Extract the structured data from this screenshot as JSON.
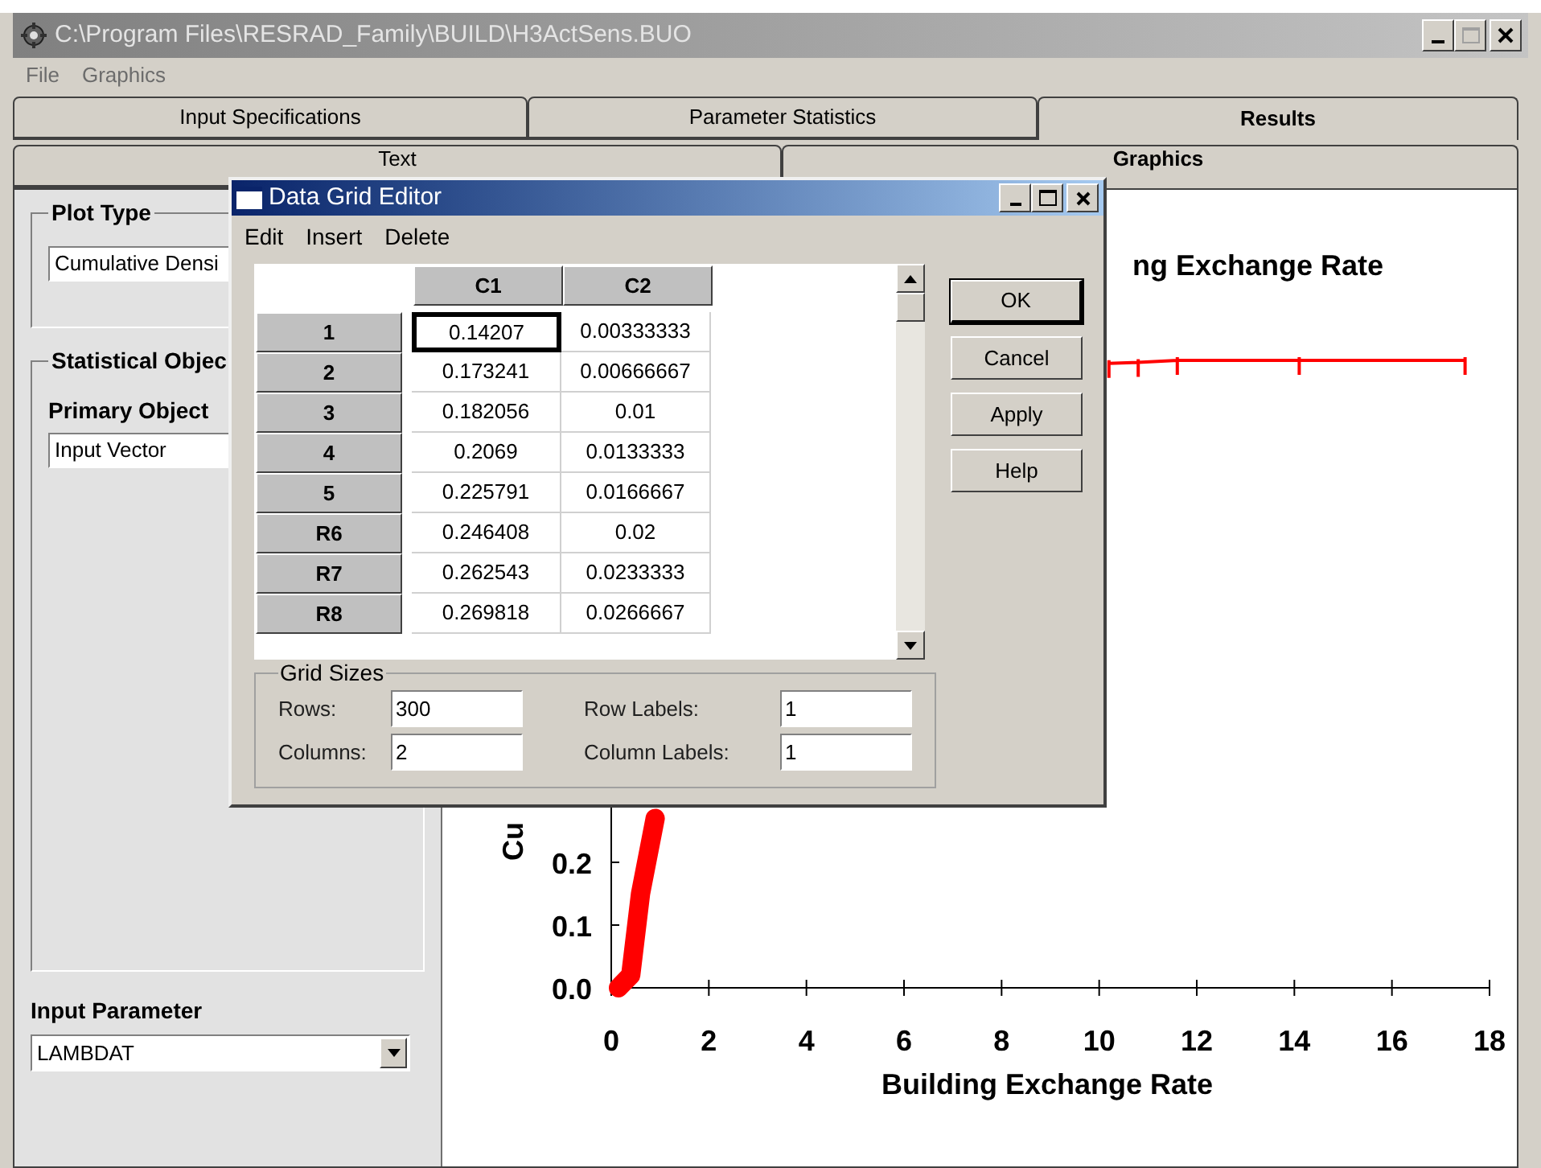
{
  "window": {
    "title": "C:\\Program Files\\RESRAD_Family\\BUILD\\H3ActSens.BUO"
  },
  "menu": [
    "File",
    "Graphics"
  ],
  "tabs": [
    {
      "label": "Input Specifications",
      "selected": false
    },
    {
      "label": "Parameter Statistics",
      "selected": false
    },
    {
      "label": "Results",
      "selected": true
    }
  ],
  "subtabs": [
    {
      "label": "Text",
      "selected": false
    },
    {
      "label": "Graphics",
      "selected": true
    }
  ],
  "left_panel": {
    "plot_type": {
      "title": "Plot Type",
      "value": "Cumulative Densi"
    },
    "statistical_objects": {
      "title": "Statistical Objec",
      "primary_label": "Primary Object",
      "primary_value": "Input Vector"
    },
    "input_parameter": {
      "label": "Input Parameter",
      "value": "LAMBDAT"
    }
  },
  "chart": {
    "chart_data": {
      "type": "line",
      "title": "ng Exchange Rate",
      "xlabel": "Building Exchange Rate",
      "ylabel": "Cu",
      "x": [
        0.15,
        0.4,
        0.6,
        0.9,
        5,
        10.2,
        10.8,
        11.6,
        14.1,
        17.5
      ],
      "series": [
        {
          "color": "#ff0000",
          "values": [
            0,
            0.02,
            0.15,
            0.27,
            null,
            0.995,
            0.997,
            1,
            1,
            1
          ]
        }
      ],
      "xlim": [
        0,
        18
      ],
      "ylim": [
        0,
        1
      ],
      "xticks": [
        0,
        2,
        4,
        6,
        8,
        10,
        12,
        14,
        16,
        18
      ],
      "yticks": [
        {
          "value": 0,
          "label": "0.0"
        },
        {
          "value": 0.1,
          "label": "0.1"
        },
        {
          "value": 0.2,
          "label": "0.2"
        }
      ]
    }
  },
  "dialog": {
    "title": "Data Grid Editor",
    "menu": [
      "Edit",
      "Insert",
      "Delete"
    ],
    "columns": [
      "C1",
      "C2"
    ],
    "rows": [
      {
        "label": "1",
        "cells": [
          {
            "value": "0.14207",
            "selected": true
          },
          {
            "value": "0.00333333",
            "selected": false
          }
        ]
      },
      {
        "label": "2",
        "cells": [
          {
            "value": "0.173241",
            "selected": false
          },
          {
            "value": "0.00666667",
            "selected": false
          }
        ]
      },
      {
        "label": "3",
        "cells": [
          {
            "value": "0.182056",
            "selected": false
          },
          {
            "value": "0.01",
            "selected": false
          }
        ]
      },
      {
        "label": "4",
        "cells": [
          {
            "value": "0.2069",
            "selected": false
          },
          {
            "value": "0.0133333",
            "selected": false
          }
        ]
      },
      {
        "label": "5",
        "cells": [
          {
            "value": "0.225791",
            "selected": false
          },
          {
            "value": "0.0166667",
            "selected": false
          }
        ]
      },
      {
        "label": "R6",
        "cells": [
          {
            "value": "0.246408",
            "selected": false
          },
          {
            "value": "0.02",
            "selected": false
          }
        ]
      },
      {
        "label": "R7",
        "cells": [
          {
            "value": "0.262543",
            "selected": false
          },
          {
            "value": "0.0233333",
            "selected": false
          }
        ]
      },
      {
        "label": "R8",
        "cells": [
          {
            "value": "0.269818",
            "selected": false
          },
          {
            "value": "0.0266667",
            "selected": false
          }
        ]
      }
    ],
    "buttons": [
      {
        "label": "OK",
        "default": true
      },
      {
        "label": "Cancel",
        "default": false
      },
      {
        "label": "Apply",
        "default": false
      },
      {
        "label": "Help",
        "default": false
      }
    ],
    "grid_sizes": {
      "title": "Grid Sizes",
      "fields": [
        {
          "label": "Rows:",
          "value": "300"
        },
        {
          "label": "Row Labels:",
          "value": "1"
        },
        {
          "label": "Columns:",
          "value": "2"
        },
        {
          "label": "Column Labels:",
          "value": "1"
        }
      ]
    }
  }
}
